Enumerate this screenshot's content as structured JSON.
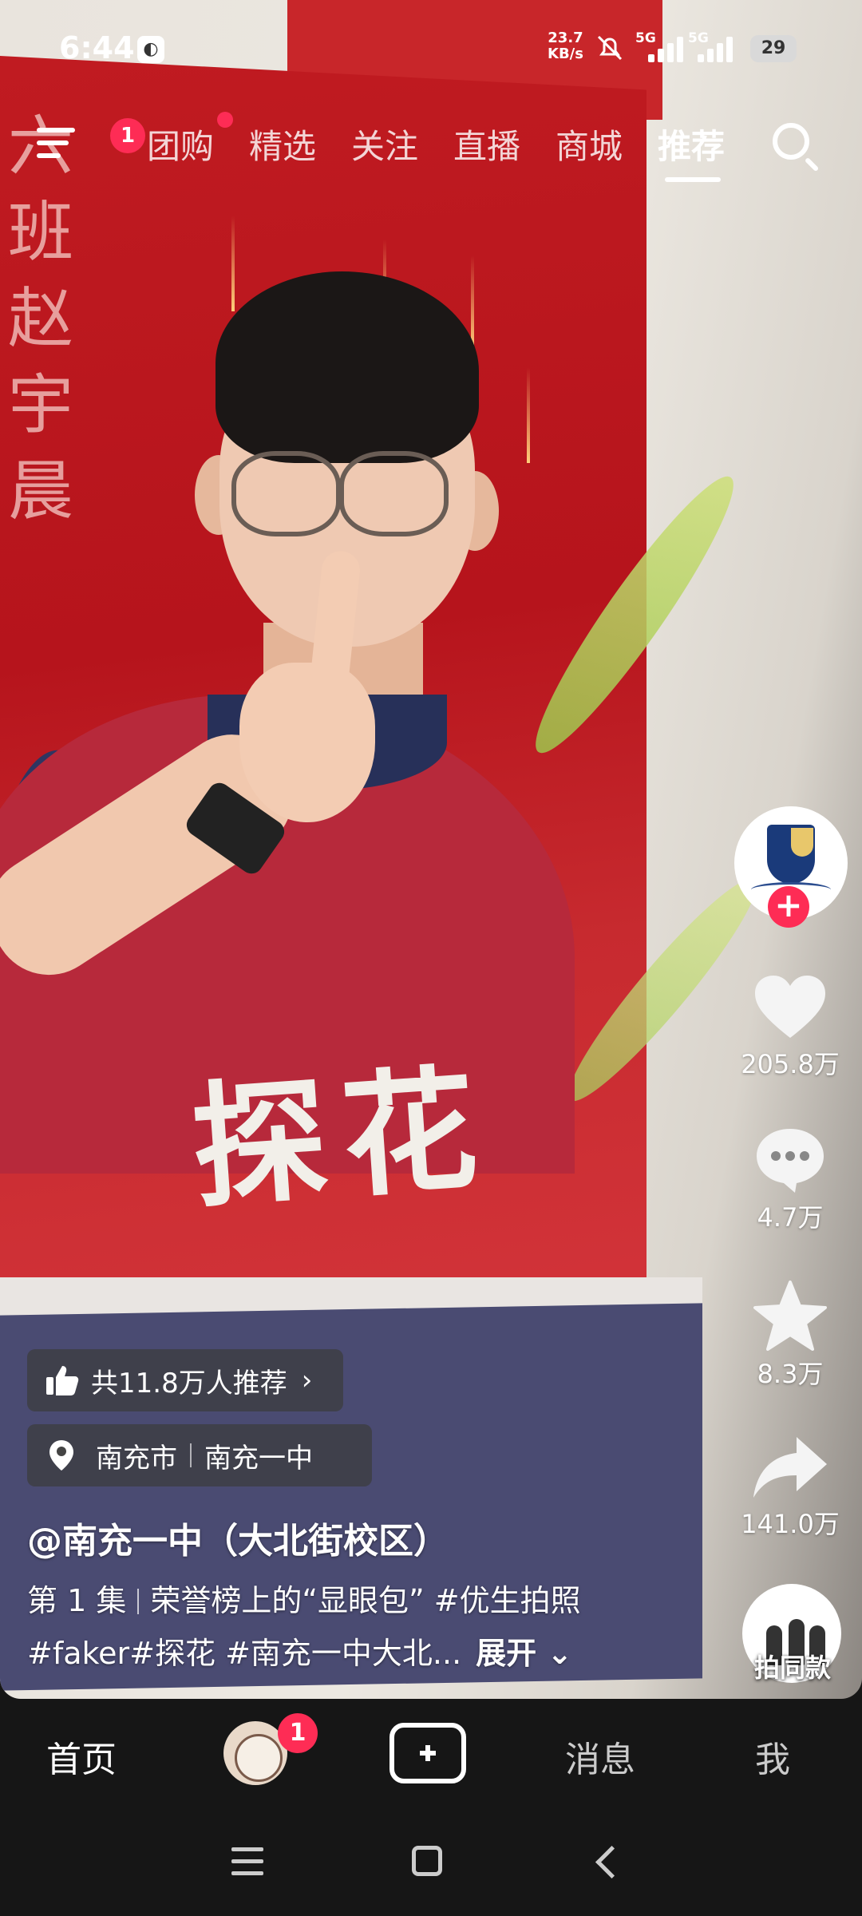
{
  "status_bar": {
    "time": "6:44",
    "net_speed_value": "23.7",
    "net_speed_unit": "KB/s",
    "sim1": "5G",
    "sim2": "5G",
    "battery": "29"
  },
  "top_nav": {
    "menu_badge": "1",
    "tabs": [
      "团购",
      "精选",
      "关注",
      "直播",
      "商城",
      "推荐"
    ],
    "active_tab": "推荐"
  },
  "poster": {
    "side_text": "六班 赵宇晨",
    "big_text": "探花"
  },
  "actions": {
    "likes": "205.8万",
    "comments": "4.7万",
    "favorites": "8.3万",
    "shares": "141.0万",
    "same_style": "拍同款",
    "follow_symbol": "+"
  },
  "info": {
    "recommend": "共11.8万人推荐",
    "location_city": "南充市",
    "location_place": "南充一中",
    "author": "@南充一中（大北街校区）",
    "episode": "第 1 集",
    "title": "荣誉榜上的“显眼包” #优生拍照",
    "tags": "#faker#探花  #南充一中大北...",
    "expand": "展开"
  },
  "tab_bar": {
    "home": "首页",
    "messages": "消息",
    "me": "我",
    "friends_badge": "1"
  },
  "colors": {
    "accent": "#fe2c55",
    "bar_bg": "#161616"
  }
}
